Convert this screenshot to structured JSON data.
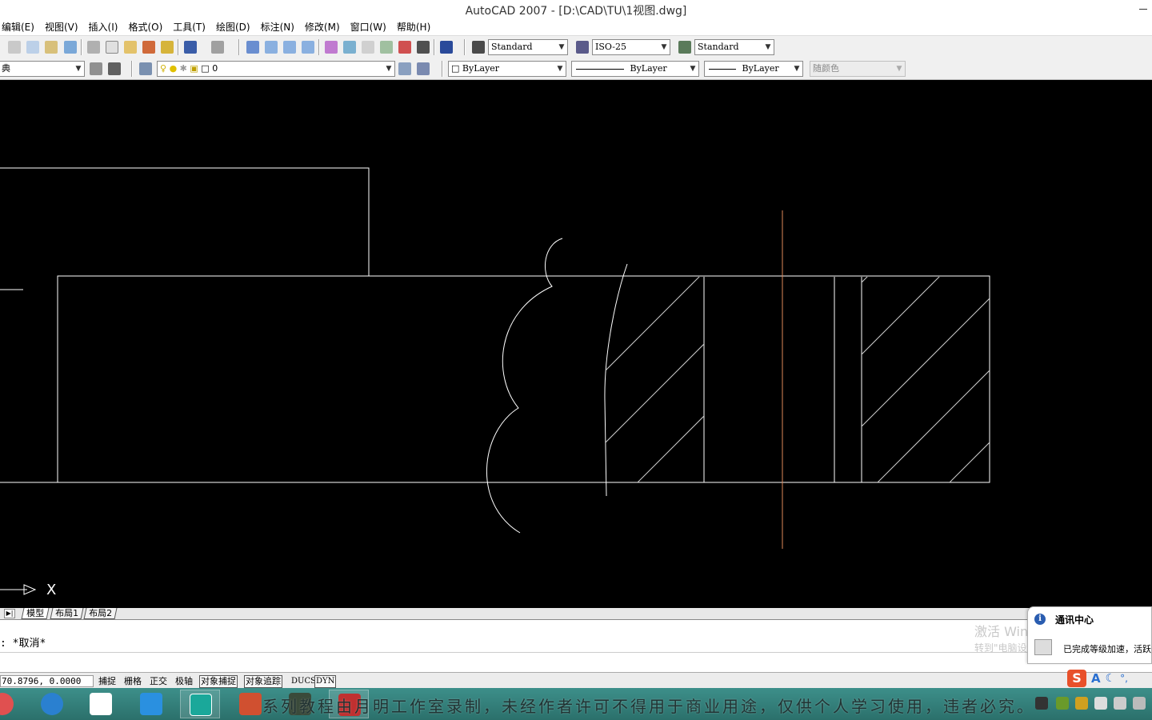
{
  "window": {
    "title": "AutoCAD 2007 - [D:\\CAD\\TU\\1视图.dwg]"
  },
  "menu": {
    "items": [
      "编辑(E)",
      "视图(V)",
      "插入(I)",
      "格式(O)",
      "工具(T)",
      "绘图(D)",
      "标注(N)",
      "修改(M)",
      "窗口(W)",
      "帮助(H)"
    ]
  },
  "toolbar_styles": {
    "text_style": "Standard",
    "dim_style": "ISO-25",
    "table_style": "Standard"
  },
  "toolbar_layers": {
    "workspace": "典",
    "layer": "0",
    "color": "ByLayer",
    "linetype": "ByLayer",
    "lineweight": "ByLayer",
    "plotstyle": "随颜色"
  },
  "canvas": {
    "ucs_x_label": "X",
    "colors": {
      "background": "#000000",
      "geometry": "#ffffff",
      "centerline": "#e08a5a"
    }
  },
  "layout_tabs": {
    "tabs": [
      "模型",
      "布局1",
      "布局2"
    ],
    "active": "模型"
  },
  "command": {
    "history_line": ": *取消*"
  },
  "status": {
    "coordinates": "70.8796, 0.0000",
    "toggles": [
      "捕捉",
      "栅格",
      "正交",
      "极轴",
      "对象捕捉",
      "对象追踪",
      "DUCS",
      "DYN"
    ]
  },
  "notification": {
    "title": "通讯中心",
    "message": "已完成等级加速，活跃"
  },
  "windows_watermark": {
    "line1": "激活 Windows",
    "line2": "转到\"电脑设置\"以激活"
  },
  "taskbar": {
    "watermark": "系列教程由月明工作室录制，未经作者许可不得用于商业用途，仅供个人学习使用，违者必究。"
  },
  "icons": {
    "info": "info-icon",
    "ime": "sogou-ime-icon"
  }
}
